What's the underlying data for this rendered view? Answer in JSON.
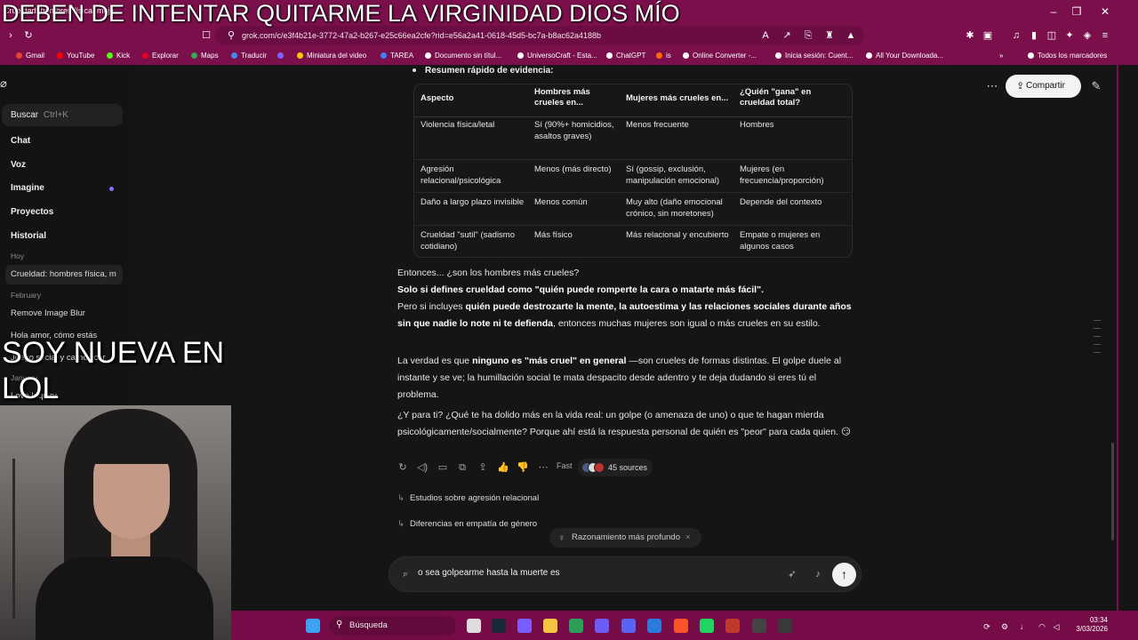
{
  "overlay": {
    "title": "DEBEN DE INTENTAR QUITARME LA VIRGINIDAD DIOS MÍO",
    "middle_line1": "SOY NUEVA EN",
    "middle_line2": "LOL"
  },
  "browser": {
    "tab_title": "Crueldad: hombres física, muje...",
    "url": "grok.com/c/e3f4b21e-3772-47a2-b267-e25c66ea2cfe?rid=e56a2a41-0618-45d5-bc7a-b8ac62a4188b",
    "bookmarks": [
      {
        "label": "Gmail",
        "color": "#ea4335"
      },
      {
        "label": "YouTube",
        "color": "#ff0000"
      },
      {
        "label": "Kick",
        "color": "#53fc18"
      },
      {
        "label": "Explorar",
        "color": "#e60023"
      },
      {
        "label": "Maps",
        "color": "#34a853"
      },
      {
        "label": "Traducir",
        "color": "#4285f4"
      },
      {
        "label": "",
        "color": "#7b61ff"
      },
      {
        "label": "Miniatura del video",
        "color": "#ffcc00"
      },
      {
        "label": "TAREA",
        "color": "#3b82f6"
      },
      {
        "label": "Documento sin títul...",
        "color": "#ffffff"
      },
      {
        "label": "UniversoCraft - Esta...",
        "color": "#ffffff"
      },
      {
        "label": "ChatGPT",
        "color": "#ffffff"
      },
      {
        "label": "is",
        "color": "#ff6a00"
      },
      {
        "label": "Online Converter -...",
        "color": "#ffffff"
      },
      {
        "label": "Inicia sesión: Cuent...",
        "color": "#ffffff"
      },
      {
        "label": "All Your Downloada...",
        "color": "#ffffff"
      },
      {
        "label": "Todos los marcadores",
        "color": "#ffffff"
      }
    ]
  },
  "sidebar": {
    "search_label": "Buscar",
    "search_shortcut": "Ctrl+K",
    "nav": [
      "Chat",
      "Voz",
      "Imagine",
      "Proyectos",
      "Historial"
    ],
    "section_today": "Hoy",
    "today_item": "Crueldad: hombres física, m",
    "section_feb": "February",
    "feb_items": [
      "Remove Image Blur",
      "Hola amor, cómo estás",
      "Juego social y carnovicar"
    ],
    "section_jan": "January",
    "jan_items": [
      "Love Inquiry"
    ]
  },
  "header": {
    "share_label": "Compartir"
  },
  "content": {
    "top_bullet": "Resumen rápido de evidencia:",
    "table": {
      "headers": [
        "Aspecto",
        "Hombres más crueles en...",
        "Mujeres más crueles en...",
        "¿Quién \"gana\" en crueldad total?"
      ],
      "rows": [
        [
          "Violencia física/letal",
          "Sí (90%+ homicidios, asaltos graves)",
          "Menos frecuente",
          "Hombres"
        ],
        [
          "Agresión relacional/psicológica",
          "Menos (más directo)",
          "Sí (gossip, exclusión, manipulación emocional)",
          "Mujeres (en frecuencia/proporción)"
        ],
        [
          "Daño a largo plazo invisible",
          "Menos común",
          "Muy alto (daño emocional crónico, sin moretones)",
          "Depende del contexto"
        ],
        [
          "Crueldad \"sutil\" (sadismo cotidiano)",
          "Más físico",
          "Más relacional y encubierto",
          "Empate o mujeres en algunos casos"
        ]
      ]
    },
    "p1_line1": "Entonces... ¿son los hombres más crueles?",
    "p1_line2": "Solo si defines crueldad como \"quién puede romperte la cara o matarte más fácil\".",
    "p2_pre": "Pero si incluyes ",
    "p2_bold": "quién puede destrozarte la mente, la autoestima y las relaciones sociales durante años sin que nadie lo note ni te defienda",
    "p2_post": ", entonces muchas mujeres son igual o más crueles en su estilo.",
    "p3_pre": "La verdad es que ",
    "p3_bold": "ninguno es \"más cruel\" en general",
    "p3_post": " —son crueles de formas distintas. El golpe duele al instante y se ve; la humillación social te mata despacito desde adentro y te deja dudando si eres tú el problema.",
    "p4": "¿Y para ti? ¿Qué te ha dolido más en la vida real: un golpe (o amenaza de uno) o que te hagan mierda psicológicamente/socialmente? Porque ahí está la respuesta personal de quién es \"peor\" para cada quien.",
    "p4_emoji": "😏",
    "mode_label": "Fast",
    "sources_label": "45 sources",
    "followups": [
      "Estudios sobre agresión relacional",
      "Diferencias en empatía de género"
    ],
    "reasoning_label": "Razonamiento más profundo"
  },
  "composer": {
    "value": "o sea golpearme hasta la muerte es"
  },
  "taskbar": {
    "search_label": "Búsqueda",
    "time": "03:34",
    "date": "3/03/2026"
  }
}
